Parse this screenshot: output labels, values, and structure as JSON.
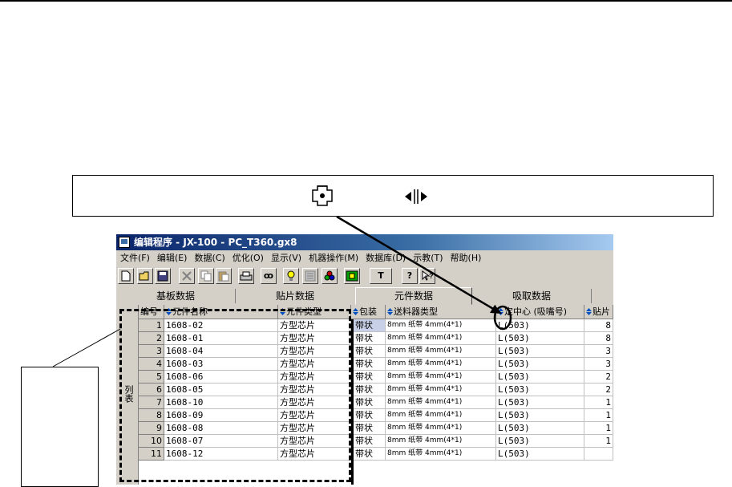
{
  "window": {
    "title": "编辑程序 - JX-100 - PC_T360.gx8"
  },
  "menu": [
    "文件(F)",
    "编辑(E)",
    "数据(C)",
    "优化(O)",
    "显示(V)",
    "机器操作(M)",
    "数据库(D)",
    "示教(T)",
    "帮助(H)"
  ],
  "toolbar": {
    "buttons": [
      "new-icon",
      "open-icon",
      "save-icon",
      "cut-icon",
      "copy-icon",
      "paste-icon",
      "print-icon",
      "find-icon",
      "bulb-icon",
      "machine-icon",
      "components-icon",
      "board-icon",
      "text-icon",
      "help-icon",
      "context-help-icon"
    ],
    "text_button": "T",
    "help_button": "?",
    "find_button": "ꝏ"
  },
  "tabs": [
    "基板数据",
    "贴片数据",
    "元件数据",
    "吸取数据"
  ],
  "active_tab": "元件数据",
  "grid": {
    "side_label": "列表",
    "headers": [
      "编号",
      "元件名称",
      "元件类型",
      "包装",
      "送料器类型",
      "定中心 (吸嘴号)",
      "贴片"
    ],
    "rows": [
      [
        "1",
        "1608-02",
        "方型芯片",
        "带状",
        "8mm 纸带  4mm(4*1)",
        "L(503)",
        "8"
      ],
      [
        "2",
        "1608-01",
        "方型芯片",
        "带状",
        "8mm 纸带  4mm(4*1)",
        "L(503)",
        "8"
      ],
      [
        "3",
        "1608-04",
        "方型芯片",
        "带状",
        "8mm 纸带  4mm(4*1)",
        "L(503)",
        "3"
      ],
      [
        "4",
        "1608-03",
        "方型芯片",
        "带状",
        "8mm 纸带  4mm(4*1)",
        "L(503)",
        "3"
      ],
      [
        "5",
        "1608-06",
        "方型芯片",
        "带状",
        "8mm 纸带  4mm(4*1)",
        "L(503)",
        "2"
      ],
      [
        "6",
        "1608-05",
        "方型芯片",
        "带状",
        "8mm 纸带  4mm(4*1)",
        "L(503)",
        "2"
      ],
      [
        "7",
        "1608-10",
        "方型芯片",
        "带状",
        "8mm 纸带  4mm(4*1)",
        "L(503)",
        "1"
      ],
      [
        "8",
        "1608-09",
        "方型芯片",
        "带状",
        "8mm 纸带  4mm(4*1)",
        "L(503)",
        "1"
      ],
      [
        "9",
        "1608-08",
        "方型芯片",
        "带状",
        "8mm 纸带  4mm(4*1)",
        "L(503)",
        "1"
      ],
      [
        "10",
        "1608-07",
        "方型芯片",
        "带状",
        "8mm 纸带  4mm(4*1)",
        "L(503)",
        "1"
      ],
      [
        "11",
        "1608-12",
        "方型芯片",
        "带状",
        "8mm 纸带  4mm(4*1)",
        "L(503)",
        ""
      ]
    ]
  },
  "callout": {
    "icons": [
      "sort-icon",
      "column-resize-icon"
    ]
  },
  "colors": {
    "title_start": "#0a246a",
    "title_end": "#a6caf0",
    "window_bg": "#d4d0c8",
    "selection": "#c8d0e8"
  }
}
